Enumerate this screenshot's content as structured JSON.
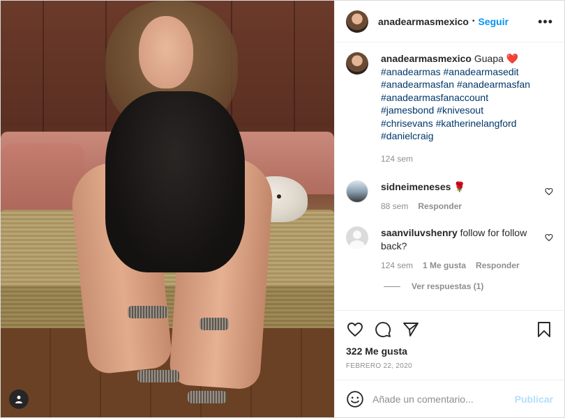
{
  "header": {
    "username": "anadearmasmexico",
    "separator": "•",
    "follow_label": "Seguir",
    "more_label": "•••"
  },
  "caption": {
    "username": "anadearmasmexico",
    "text": "Guapa",
    "emoji": "❤️",
    "hashtags": "#anadearmas #anadearmasedit #anadearmasfan #anadearmasfan #anadearmasfanaccount #jamesbond #knivesout #chrisevans #katherinelangford #danielcraig",
    "time": "124 sem"
  },
  "comments": [
    {
      "username": "sidneimeneses",
      "text": "🌹",
      "time": "88 sem",
      "likes": "",
      "reply_label": "Responder"
    },
    {
      "username": "saanviluvshenry",
      "text": "follow for follow back?",
      "time": "124 sem",
      "likes": "1 Me gusta",
      "reply_label": "Responder"
    }
  ],
  "view_replies_label": "Ver respuestas (1)",
  "actions": {
    "likes_count": "322 Me gusta",
    "date": "FEBRERO 22, 2020"
  },
  "add_comment": {
    "placeholder": "Añade un comentario...",
    "publish_label": "Publicar"
  },
  "icons": {
    "like": "heart-icon",
    "comment": "comment-bubble-icon",
    "share": "paper-plane-icon",
    "save": "bookmark-icon",
    "emoji": "smiley-icon",
    "tag": "user-tag-icon",
    "comment_like": "heart-icon"
  },
  "colors": {
    "accent": "#0095f6",
    "hashtag": "#00376b",
    "muted": "#8e8e8e",
    "publish_disabled": "#b2dffc"
  }
}
